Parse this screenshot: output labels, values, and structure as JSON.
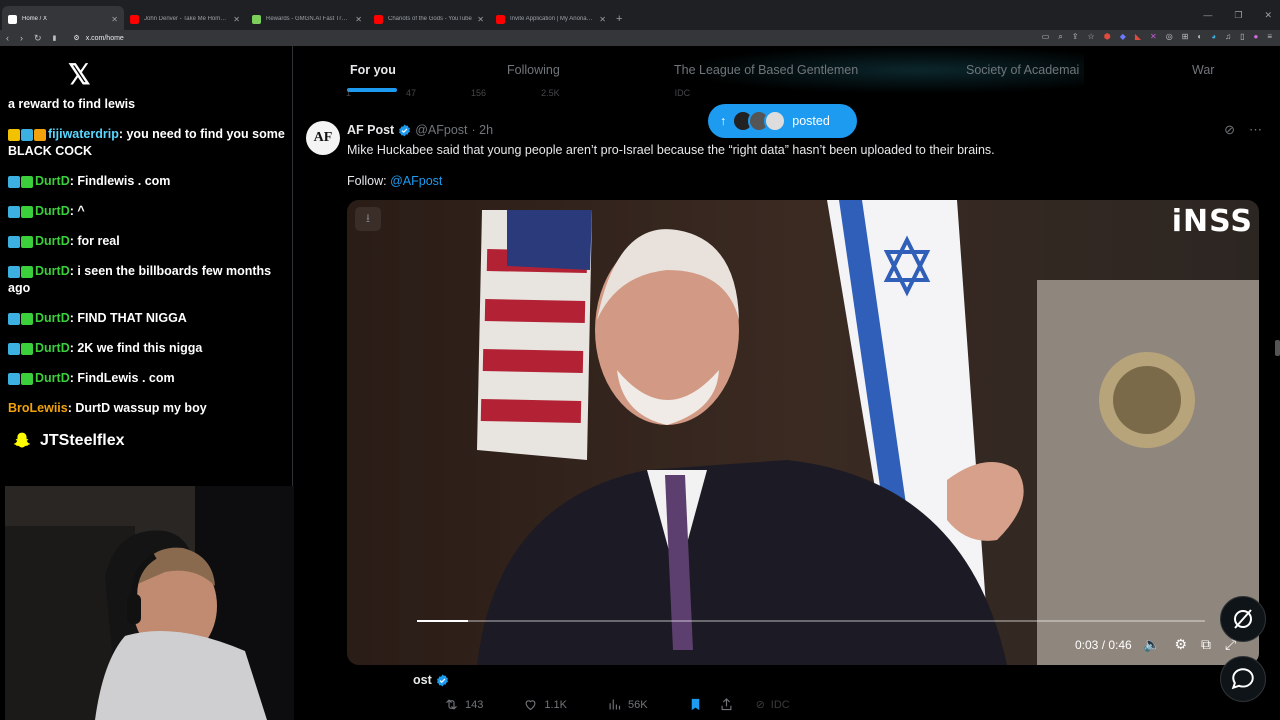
{
  "browser": {
    "tabs": [
      {
        "title": "Home / X",
        "icon": "x-logo-icon",
        "color": "#ffffff",
        "active": true
      },
      {
        "title": "John Denver - Take Me Home, Count",
        "icon": "youtube-icon",
        "color": "#ff0000",
        "active": false
      },
      {
        "title": "Rewards - GMGN.AI Fast Trade, Fast",
        "icon": "gmgn-icon",
        "color": "#7ccf5a",
        "active": false
      },
      {
        "title": "Chariots of the Gods - YouTube",
        "icon": "youtube-icon",
        "color": "#ff0000",
        "active": false
      },
      {
        "title": "Invite Application | My Anonamouse",
        "icon": "mam-icon",
        "color": "#ff0000",
        "active": false
      }
    ],
    "url": "x.com/home"
  },
  "stream": {
    "chat": [
      {
        "user": "",
        "text": "a reward to find lewis",
        "user_color": "#ffffff",
        "badges": []
      },
      {
        "user": "fijiwaterdrip",
        "text": ": you need to find you some BLACK COCK",
        "user_color": "#59d8ff",
        "badges": [
          "#f2c200",
          "#3cb0e0",
          "#f2a20c"
        ]
      },
      {
        "user": "DurtD",
        "text": ": Findlewis . com",
        "user_color": "#3ccf3c",
        "badges": [
          "#3cb0e0",
          "#3ccf3c"
        ]
      },
      {
        "user": "DurtD",
        "text": ": ^",
        "user_color": "#3ccf3c",
        "badges": [
          "#3cb0e0",
          "#3ccf3c"
        ]
      },
      {
        "user": "DurtD",
        "text": ": for real",
        "user_color": "#3ccf3c",
        "badges": [
          "#3cb0e0",
          "#3ccf3c"
        ]
      },
      {
        "user": "DurtD",
        "text": ": i seen the billboards few months ago",
        "user_color": "#3ccf3c",
        "badges": [
          "#3cb0e0",
          "#3ccf3c"
        ]
      },
      {
        "user": "DurtD",
        "text": ": FIND THAT NIGGA",
        "user_color": "#3ccf3c",
        "badges": [
          "#3cb0e0",
          "#3ccf3c"
        ]
      },
      {
        "user": "DurtD",
        "text": ": 2K we find this nigga",
        "user_color": "#3ccf3c",
        "badges": [
          "#3cb0e0",
          "#3ccf3c"
        ]
      },
      {
        "user": "DurtD",
        "text": ": FindLewis . com",
        "user_color": "#3ccf3c",
        "badges": [
          "#3cb0e0",
          "#3ccf3c"
        ]
      },
      {
        "user": "BroLewiis",
        "text": ": DurtD wassup my boy",
        "user_color": "#f2a20c",
        "badges": []
      }
    ],
    "snapchat": "JTSteelflex"
  },
  "feed": {
    "tabs": [
      "For you",
      "Following",
      "The League of Based Gentlemen",
      "Society of Academai",
      "War"
    ],
    "posted_pill": "posted",
    "prev_actions": [
      "1",
      "47",
      "156",
      "2.5K",
      "IDC"
    ],
    "tweet": {
      "avatar_text": "AF",
      "name": "AF Post",
      "handle": "@AFpost",
      "time": "· 2h",
      "text": "Mike Huckabee said that young people aren’t pro-Israel because the “right data” hasn’t been uploaded to their brains.",
      "follow_label": "Follow: ",
      "follow_link": "@AFpost",
      "video": {
        "watermark": "iNSS",
        "time": "0:03 / 0:46",
        "progress": 0.065
      }
    },
    "bottom_user_suffix": "ost",
    "actions": {
      "retweets": "143",
      "likes": "1.1K",
      "views": "56K",
      "grok": "IDC"
    }
  }
}
